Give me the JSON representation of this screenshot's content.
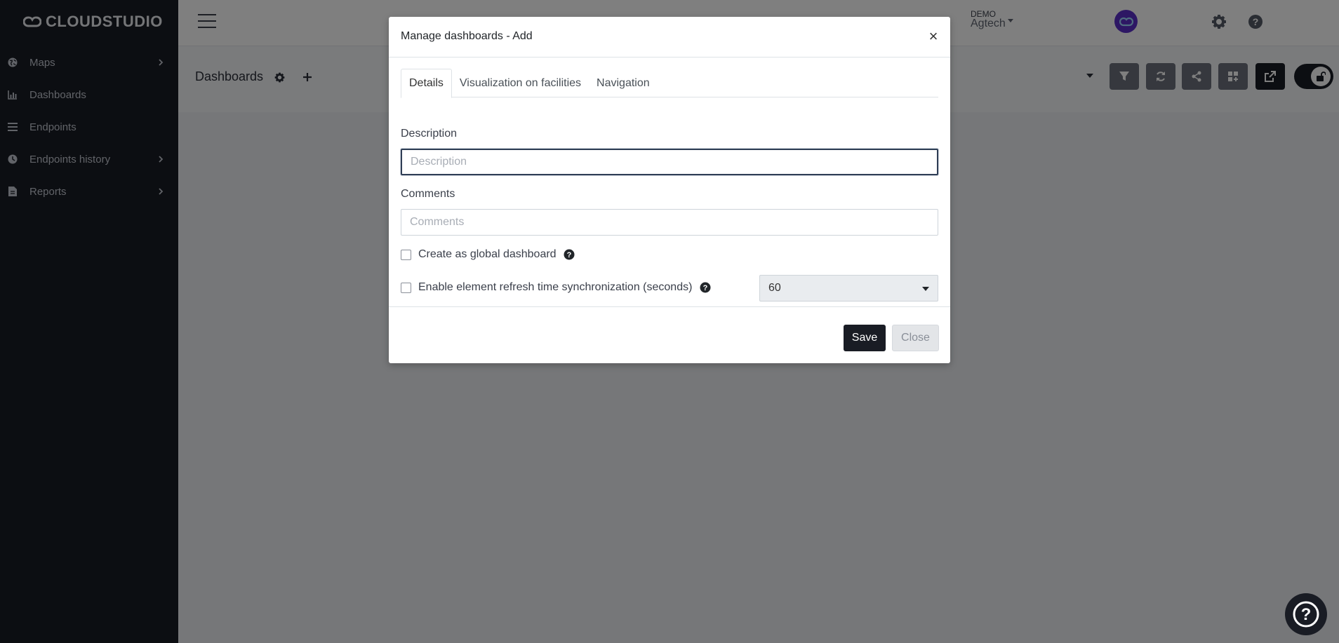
{
  "app": {
    "logo_text": "CLOUDSTUDIO",
    "user": {
      "role": "DEMO",
      "org": "Agtech"
    }
  },
  "sidebar": {
    "items": [
      {
        "label": "Maps",
        "icon": "globe-icon",
        "has_submenu": true
      },
      {
        "label": "Dashboards",
        "icon": "chart-icon",
        "has_submenu": false
      },
      {
        "label": "Endpoints",
        "icon": "list-icon",
        "has_submenu": false
      },
      {
        "label": "Endpoints history",
        "icon": "clock-icon",
        "has_submenu": true
      },
      {
        "label": "Reports",
        "icon": "file-icon",
        "has_submenu": true
      }
    ]
  },
  "page": {
    "title": "Dashboards"
  },
  "modal": {
    "title": "Manage dashboards - Add",
    "close_glyph": "×",
    "tabs": [
      {
        "label": "Details",
        "active": true
      },
      {
        "label": "Visualization on facilities",
        "active": false
      },
      {
        "label": "Navigation",
        "active": false
      }
    ],
    "description": {
      "label": "Description",
      "placeholder": "Description",
      "value": ""
    },
    "comments": {
      "label": "Comments",
      "placeholder": "Comments",
      "value": ""
    },
    "global_checkbox": {
      "label": "Create as global dashboard",
      "checked": false
    },
    "sync_checkbox": {
      "label": "Enable element refresh time synchronization (seconds)",
      "checked": false
    },
    "refresh_select": {
      "value": "60"
    },
    "buttons": {
      "save": "Save",
      "close": "Close"
    }
  },
  "colors": {
    "sidebar_bg": "#191c24",
    "primary_button": "#191c24",
    "avatar": "#5a2fc8"
  }
}
